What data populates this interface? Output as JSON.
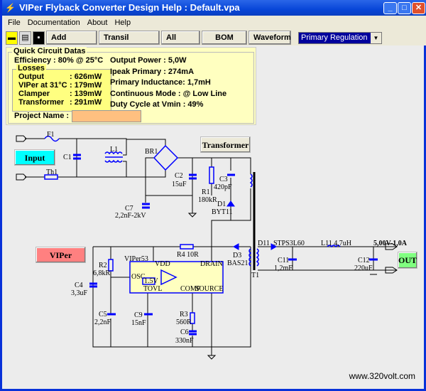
{
  "window": {
    "title": "VIPer Flyback Converter Design Help :  Default.vpa",
    "app_icon": "viper-logo-icon",
    "controls": [
      "minimize-icon",
      "maximize-icon",
      "close-icon"
    ]
  },
  "menu": [
    "File",
    "Documentation",
    "About",
    "Help"
  ],
  "toolbar": {
    "icons": [
      "open-folder-icon",
      "print-icon",
      "save-disk-icon"
    ],
    "buttons": [
      "Add Output",
      "Transil Clamper",
      "All Datas",
      "BOM",
      "Waveform"
    ],
    "mode_select": "Primary Regulation"
  },
  "quick": {
    "title": "Quick Circuit Datas",
    "efficiency": "Efficiency : 80% @ 25°C",
    "losses": {
      "title": "Losses",
      "rows": [
        [
          "Output",
          ": 626mW"
        ],
        [
          "VIPer at 31°C",
          ": 179mW"
        ],
        [
          "Clamper",
          ": 139mW"
        ],
        [
          "Transformer",
          ": 291mW"
        ]
      ]
    },
    "right": [
      "Output Power : 5,0W",
      "Ipeak Primary : 274mA",
      "Primary Inductance: 1,7mH",
      "Continuous Mode : @ Low Line",
      "Duty Cycle at Vmin : 49%"
    ],
    "project_label": "Project Name :",
    "project_value": ""
  },
  "buttons": {
    "input": "Input",
    "transformer": "Transformer",
    "viper": "VIPer",
    "out": "OUT"
  },
  "colors": {
    "input": "#00ffff",
    "viper": "#ff8080",
    "out": "#80ff80",
    "panel": "#ffffc0",
    "component": "#0000ff"
  },
  "schematic": {
    "F1": "F1",
    "C1": "C1",
    "L1": "L1",
    "Th1": "Th1",
    "BR1": "BR1",
    "C2": "C2",
    "C2v": "15uF",
    "C7": "C7",
    "C7v": "2,2nF-2kV",
    "R1": "R1",
    "R1v": "180kR",
    "C3": "C3",
    "C3v": "420pF",
    "D1": "D1",
    "D1v": "BYT11",
    "R4": "R4 10R",
    "D3": "D3",
    "D3v": "BAS21",
    "T1": "T1",
    "R2": "R2",
    "R2v": "6,8kR",
    "C4": "C4",
    "C4v": "3,3uF",
    "ic": "VIPer53",
    "vdd": "VDD",
    "drain": "DRAIN",
    "osc": "OSC",
    "tovl": "TOVL",
    "comp": "COMP",
    "source": "SOURCE",
    "ref": "1.5V",
    "C5": "C5",
    "C5v": "2,2nF",
    "C9": "C9",
    "C9v": "15nF",
    "R3": "R3",
    "R3v": "560R",
    "C6": "C6",
    "C6v": "330nF",
    "D11": "D11",
    "D11v": "STPS3L60",
    "L11": "L11 4,7uH",
    "C11": "C11",
    "C11v": "1,2mF",
    "C12": "C12",
    "C12v": "220uF",
    "output": "5,00V-1,0A"
  },
  "footer": "www.320volt.com"
}
